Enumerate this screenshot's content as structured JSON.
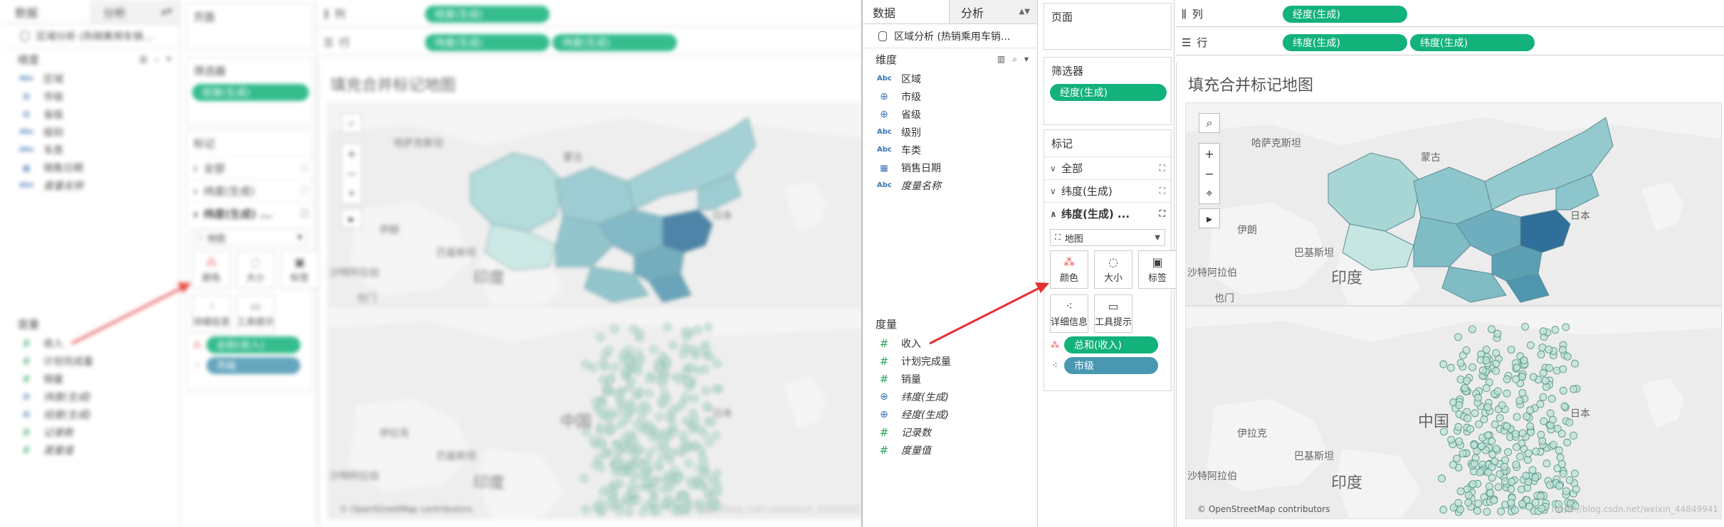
{
  "data_pane": {
    "tabs": [
      {
        "label": "数据"
      },
      {
        "label": "分析"
      }
    ],
    "source": "区域分析 (热销乘用车销...",
    "dimensions_header": "维度",
    "dimensions": [
      {
        "icon": "Abc",
        "label": "区域"
      },
      {
        "icon": "globe",
        "label": "市级"
      },
      {
        "icon": "globe",
        "label": "省级"
      },
      {
        "icon": "Abc",
        "label": "级别"
      },
      {
        "icon": "Abc",
        "label": "车类"
      },
      {
        "icon": "calendar",
        "label": "销售日期"
      },
      {
        "icon": "Abc",
        "label": "度量名称"
      }
    ],
    "measures_header": "度量",
    "measures": [
      {
        "icon": "#",
        "label": "收入"
      },
      {
        "icon": "#",
        "label": "计划完成量"
      },
      {
        "icon": "#",
        "label": "销量"
      },
      {
        "icon": "globe",
        "label": "纬度(生成)"
      },
      {
        "icon": "globe",
        "label": "经度(生成)"
      },
      {
        "icon": "#",
        "label": "记录数"
      },
      {
        "icon": "#",
        "label": "度量值"
      }
    ]
  },
  "pages_label": "页面",
  "filters": {
    "label": "筛选器",
    "pill": "经度(生成)"
  },
  "marks": {
    "label": "标记",
    "rows": [
      {
        "label": "全部",
        "arrow": "down"
      },
      {
        "label": "纬度(生成)",
        "arrow": "down"
      },
      {
        "label": "纬度(生成) ...",
        "arrow": "up"
      }
    ],
    "type_select": "地图",
    "buttons": [
      {
        "label": "颜色",
        "icon": "color-icon"
      },
      {
        "label": "大小",
        "icon": "size-icon"
      },
      {
        "label": "标签",
        "icon": "label-icon"
      },
      {
        "label": "详细信息",
        "icon": "detail-icon"
      },
      {
        "label": "工具提示",
        "icon": "tooltip-icon"
      }
    ],
    "encodings": [
      {
        "pill": "总和(收入)",
        "color": "#13b27a"
      },
      {
        "pill": "市级",
        "color": "#4a97b2"
      }
    ]
  },
  "columns": {
    "label": "列",
    "pills": [
      "经度(生成)"
    ]
  },
  "rows": {
    "label": "行",
    "pills": [
      "纬度(生成)",
      "纬度(生成)"
    ]
  },
  "view": {
    "title": "填充合并标记地图",
    "map_top_labels": [
      "哈萨克斯坦",
      "蒙古",
      "伊朗",
      "巴基斯坦",
      "印度",
      "日本",
      "沙特阿拉伯",
      "也门"
    ],
    "map_bottom_labels": [
      "印度",
      "巴基斯坦",
      "伊拉克",
      "中国",
      "日本",
      "沙特阿拉伯"
    ],
    "copyright": "© OpenStreetMap contributors",
    "watermark": "https://blog.csdn.net/weixin_44849941"
  },
  "colors": {
    "accent_green": "#13b27a",
    "accent_blue": "#4a97b2",
    "arrow_red": "#e53030"
  }
}
